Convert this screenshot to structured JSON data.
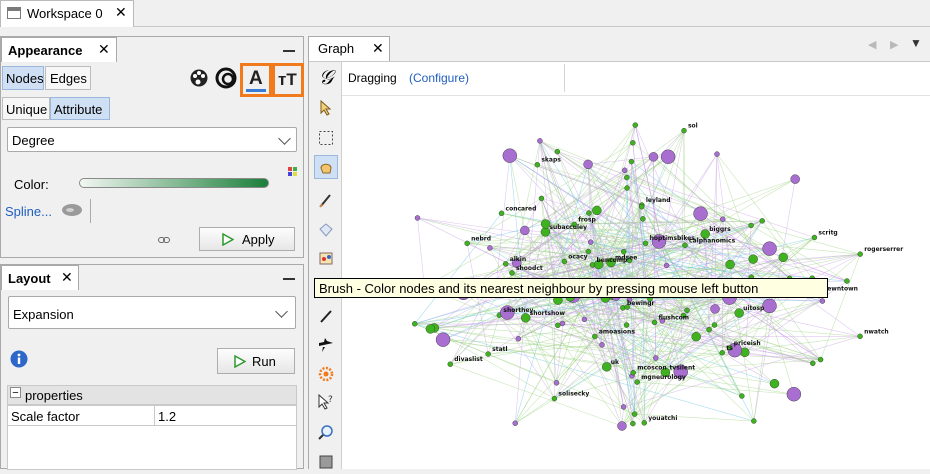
{
  "workspace": {
    "tab_label": "Workspace 0",
    "close_glyph": "✕"
  },
  "appearance": {
    "title": "Appearance",
    "close_glyph": "✕",
    "tabs": [
      "Nodes",
      "Edges"
    ],
    "subtabs": [
      "Unique",
      "Attribute"
    ],
    "selected_attribute": "Degree",
    "color_label": "Color:",
    "spline_label": "Spline...",
    "apply_label": "Apply",
    "icons": [
      "palette-icon",
      "ring-size-icon",
      "label-color-icon",
      "label-size-icon"
    ],
    "icon_text": {
      "label_color": "A",
      "label_size": "тT"
    },
    "gradient": {
      "start": "#f2f7f2",
      "end": "#1b7f3a"
    },
    "highlight_color": "#f07a1c"
  },
  "layout": {
    "title": "Layout",
    "close_glyph": "✕",
    "selected_algorithm": "Expansion",
    "run_label": "Run",
    "properties_header": "properties",
    "properties_toggle": "−",
    "property_rows": [
      {
        "name": "Scale factor",
        "value": "1.2"
      }
    ]
  },
  "graph": {
    "tab_label": "Graph",
    "close_glyph": "✕",
    "mode_label": "Dragging",
    "configure_link": "(Configure)",
    "tooltip": "Brush - Color nodes and its nearest neighbour by pressing mouse left button",
    "tools": [
      "pointer-tool",
      "rect-select-tool",
      "drag-tool",
      "painter-tool",
      "diamond-tool",
      "brush-tool",
      "pencil-tool",
      "shortest-path-tool",
      "heatmap-tool",
      "edit-tool",
      "zoom-tool",
      "stop-tool"
    ],
    "node_labels": [
      "mgneurology",
      "mdsee",
      "nwatch",
      "frosp",
      "leyland",
      "subacculey",
      "statl",
      "shorthey",
      "rogerserrer",
      "tvsilent",
      "thecar",
      "calphanomics",
      "hoptimsbikes",
      "darrenmid",
      "flushcom",
      "dewntown",
      "bewingr",
      "shortshow",
      "rexr",
      "sol",
      "nebrd",
      "uitosp",
      "shoodct",
      "youatchi",
      "divaslist",
      "pubsimes",
      "mcoscon",
      "amoasions",
      "scritg",
      "uk",
      "bencomp",
      "priceish",
      "ts",
      "biggrs",
      "concared",
      "ocacy",
      "mdstopers",
      "hwolden",
      "solisecky",
      "skaps",
      "alkin"
    ],
    "colors": {
      "node_green": "#3fb31f",
      "node_purple": "#a86fd0",
      "edge_green": "#9bd17f",
      "edge_purple": "#c79ae6",
      "edge_blue": "#5fc3e6"
    }
  }
}
